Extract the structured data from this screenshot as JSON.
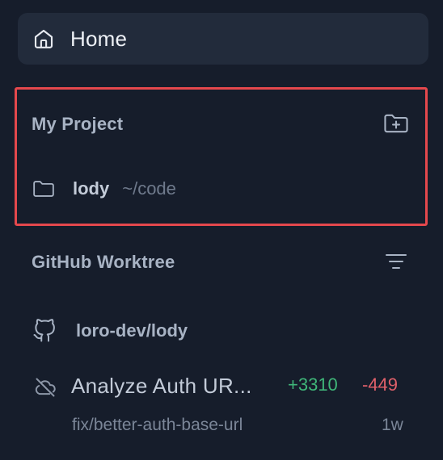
{
  "home": {
    "label": "Home",
    "icon": "home-icon"
  },
  "my_project": {
    "title": "My Project",
    "action_icon": "folder-plus-icon",
    "projects": [
      {
        "icon": "folder-icon",
        "name": "lody",
        "path": "~/code"
      }
    ]
  },
  "github_worktree": {
    "title": "GitHub Worktree",
    "action_icon": "filter-icon",
    "repo": {
      "icon": "github-icon",
      "name": "loro-dev/lody"
    },
    "worktrees": [
      {
        "icon": "cloud-off-icon",
        "title": "Analyze Auth UR...",
        "additions": "+3310",
        "deletions": "-449",
        "branch": "fix/better-auth-base-url",
        "time": "1w"
      }
    ]
  },
  "colors": {
    "background": "#161d2b",
    "home_bg": "#222b3b",
    "highlight": "#e5484d",
    "additions": "#3fb679",
    "deletions": "#e0606a"
  }
}
